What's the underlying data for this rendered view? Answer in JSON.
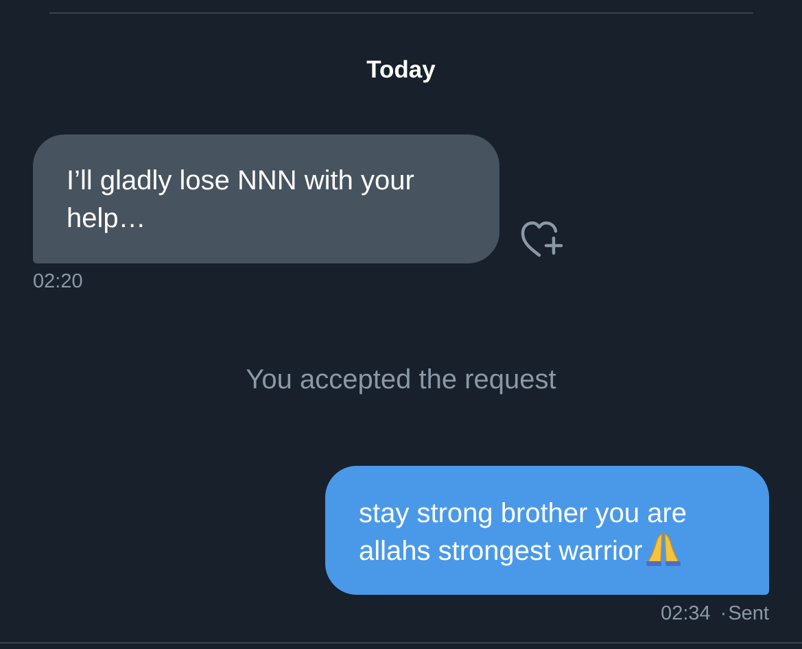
{
  "conversation": {
    "date_header": "Today",
    "system_note": "You accepted the request",
    "messages": [
      {
        "direction": "received",
        "text": "I’ll gladly lose NNN with your help…",
        "time": "02:20",
        "reaction_icon": "heart-plus-icon"
      },
      {
        "direction": "sent",
        "text": "stay strong brother you are allahs strongest warrior",
        "emoji": "folded-hands-emoji",
        "time": "02:34",
        "separator": "·",
        "status": "Sent"
      }
    ]
  },
  "colors": {
    "background": "#17202b",
    "received_bubble": "#47535f",
    "sent_bubble": "#4a99e9",
    "muted_text": "#8b98a5",
    "divider": "#38444d"
  }
}
